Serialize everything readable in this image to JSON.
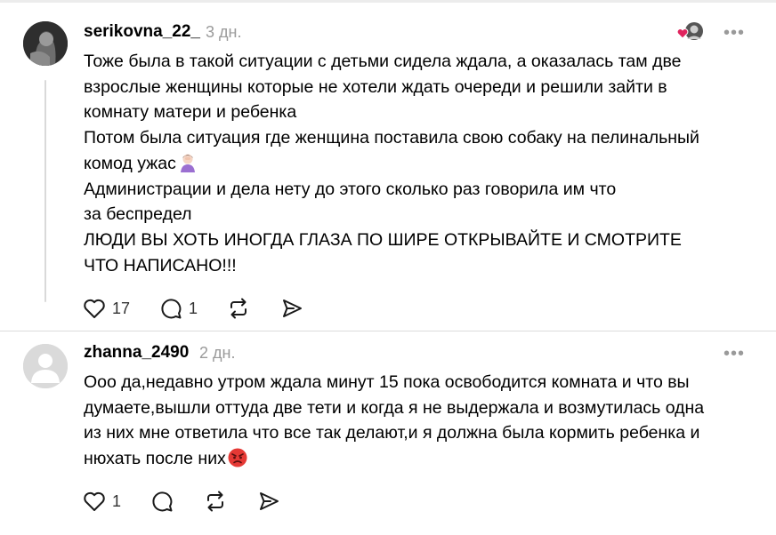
{
  "comments": [
    {
      "username": "serikovna_22_",
      "time": "3 дн.",
      "more_label": "•••",
      "lines": [
        "Тоже была в такой ситуации с детьми сидела ждала, а оказалась там две",
        "взрослые женщины которые не хотели ждать очереди и решили зайти в",
        "комнату матери и ребенка",
        "Потом была ситуация где женщина поставила свою собаку на пелинальный",
        "комод ужас",
        "Администрации и дела нету до этого сколько раз говорила им что",
        "за беспредел",
        "ЛЮДИ ВЫ ХОТЬ ИНОГДА ГЛАЗА ПО ШИРЕ ОТКРЫВАЙТЕ И СМОТРИТЕ",
        "ЧТО НАПИСАНО!!!"
      ],
      "emoji": "woman-facepalming-emoji",
      "likes": "17",
      "replies": "1",
      "liked_by": "heart-avatar-icon"
    },
    {
      "username": "zhanna_2490",
      "time": "2 дн.",
      "more_label": "•••",
      "lines": [
        "Ооо да,недавно утром ждала минут 15 пока освободится комната и что вы",
        "думаете,вышли оттуда две тети и когда я не выдержала и возмутилась одна",
        "из них мне ответила что все так делают,и я должна была кормить ребенка и",
        "нюхать после них"
      ],
      "emoji": "angry-face-emoji",
      "likes": "1",
      "replies": ""
    }
  ],
  "icons": {
    "like": "heart-icon",
    "reply": "speech-bubble-icon",
    "repost": "repost-icon",
    "share": "send-icon"
  },
  "colors": {
    "muted": "#9a9a9a",
    "divider": "#dcdcdc",
    "heart_red": "#e0245e"
  }
}
